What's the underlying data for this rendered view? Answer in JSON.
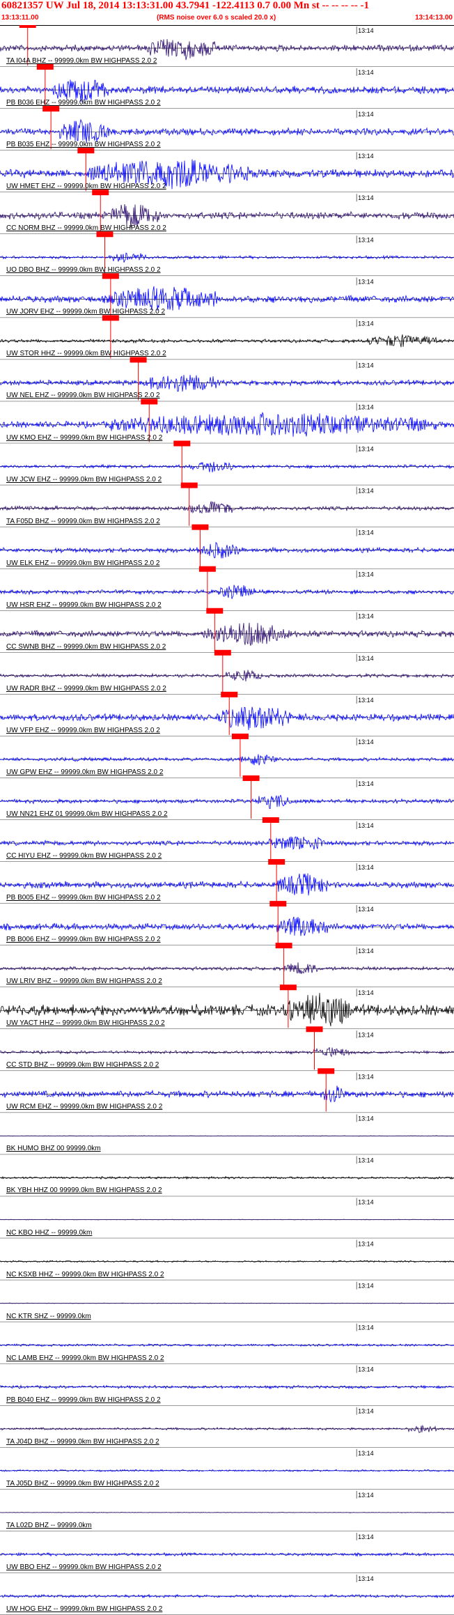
{
  "header": {
    "title": "60821357 UW Jul 18, 2014 13:13:31.00   43.7941 -122.4113  0.7 0.00 Mn st -- -- -- -- -1",
    "start_time": "13:13:11.00",
    "note": "(RMS noise over 6.0 s scaled 20.0 x)",
    "end_time": "13:14:13.00"
  },
  "colors": {
    "title": "#ff0000",
    "pick": "#ff0000",
    "trace_blue": "#0000ff",
    "trace_dark": "#2a0a6e",
    "trace_black": "#000000",
    "axis": "#000000"
  },
  "chart_data": {
    "type": "line",
    "title": "60821357 UW Jul 18, 2014 13:13:31.00   43.7941 -122.4113  0.7 0.00 Mn st -- -- -- -- -1",
    "x_axis": {
      "start": "13:13:11.00",
      "end": "13:14:13.00",
      "tick_label": "13:14",
      "tick_time_s": 49
    },
    "traces": [
      {
        "label": "TA I04A BHZ -- 99999.0km BW  HIGHPASS  2.0  2",
        "pick_s": 3.8,
        "color": "dark",
        "amp": 0.55,
        "burst": [
          20,
          30
        ]
      },
      {
        "label": "PB B036 EHZ -- 99999.0km BW  HIGHPASS  2.0  2",
        "pick_s": 6.2,
        "color": "blue",
        "amp": 0.6,
        "burst": [
          7,
          15
        ]
      },
      {
        "label": "PB B035 EHZ -- 99999.0km BW  HIGHPASS  2.0  2",
        "pick_s": 7.0,
        "color": "blue",
        "amp": 0.6,
        "burst": [
          8,
          15
        ]
      },
      {
        "label": "UW HMET EHZ -- 99999.0km BW  HIGHPASS  2.0  2",
        "pick_s": 11.8,
        "color": "blue",
        "amp": 0.7,
        "burst": [
          12,
          35
        ]
      },
      {
        "label": "CC NORM BHZ -- 99999.0km BW  HIGHPASS  2.0  2",
        "pick_s": 13.8,
        "color": "dark",
        "amp": 0.6,
        "burst": [
          15,
          22
        ]
      },
      {
        "label": "UO DBO BHZ -- 99999.0km BW  HIGHPASS  2.0  2",
        "pick_s": 14.4,
        "color": "blue",
        "amp": 0.25,
        "burst": [
          15,
          20
        ]
      },
      {
        "label": "UW JORV EHZ -- 99999.0km BW  HIGHPASS  2.0  2",
        "pick_s": 15.2,
        "color": "blue",
        "amp": 0.6,
        "burst": [
          15,
          30
        ]
      },
      {
        "label": "UW STOR HHZ -- 99999.0km BW  HIGHPASS  2.0  2",
        "pick_s": 15.2,
        "color": "black",
        "amp": 0.3,
        "burst": [
          50,
          60
        ]
      },
      {
        "label": "UW NEL EHZ -- 99999.0km BW  HIGHPASS  2.0  2",
        "pick_s": 19.0,
        "color": "blue",
        "amp": 0.45,
        "burst": [
          20,
          30
        ]
      },
      {
        "label": "UW KMO EHZ -- 99999.0km BW  HIGHPASS  2.0  2",
        "pick_s": 20.5,
        "color": "blue",
        "amp": 0.55,
        "burst": [
          15,
          60
        ]
      },
      {
        "label": "UW JCW EHZ -- 99999.0km BW  HIGHPASS  2.0  2",
        "pick_s": 25.0,
        "color": "blue",
        "amp": 0.3,
        "burst": [
          26,
          32
        ]
      },
      {
        "label": "TA F05D BHZ -- 99999.0km BW  HIGHPASS  2.0  2",
        "pick_s": 26.0,
        "color": "dark",
        "amp": 0.35,
        "burst": [
          26,
          32
        ]
      },
      {
        "label": "UW ELK EHZ -- 99999.0km BW  HIGHPASS  2.0  2",
        "pick_s": 27.5,
        "color": "blue",
        "amp": 0.4,
        "burst": [
          27,
          33
        ]
      },
      {
        "label": "UW HSR EHZ -- 99999.0km BW  HIGHPASS  2.0  2",
        "pick_s": 28.5,
        "color": "blue",
        "amp": 0.35,
        "burst": [
          30,
          35
        ]
      },
      {
        "label": "CC SWNB BHZ -- 99999.0km BW  HIGHPASS  2.0  2",
        "pick_s": 29.5,
        "color": "dark",
        "amp": 0.55,
        "burst": [
          28,
          40
        ]
      },
      {
        "label": "UW RADR BHZ -- 99999.0km BW  HIGHPASS  2.0  2",
        "pick_s": 30.6,
        "color": "dark",
        "amp": 0.3,
        "burst": [
          31,
          36
        ]
      },
      {
        "label": "UW VFP EHZ -- 99999.0km BW  HIGHPASS  2.0  2",
        "pick_s": 31.5,
        "color": "blue",
        "amp": 0.6,
        "burst": [
          30,
          40
        ]
      },
      {
        "label": "UW GPW EHZ -- 99999.0km BW  HIGHPASS  2.0  2",
        "pick_s": 33.0,
        "color": "blue",
        "amp": 0.3,
        "burst": [
          33,
          38
        ]
      },
      {
        "label": "UW NN21 EHZ 01 99999.0km BW  HIGHPASS  2.0  2",
        "pick_s": 34.5,
        "color": "blue",
        "amp": 0.35,
        "burst": [
          35,
          40
        ]
      },
      {
        "label": "CC HIYU EHZ -- 99999.0km BW  HIGHPASS  2.0  2",
        "pick_s": 37.2,
        "color": "blue",
        "amp": 0.4,
        "burst": [
          37,
          45
        ]
      },
      {
        "label": "PB B005 EHZ -- 99999.0km BW  HIGHPASS  2.0  2",
        "pick_s": 38.0,
        "color": "blue",
        "amp": 0.55,
        "burst": [
          38,
          45
        ]
      },
      {
        "label": "PB B006 EHZ -- 99999.0km BW  HIGHPASS  2.0  2",
        "pick_s": 38.2,
        "color": "blue",
        "amp": 0.55,
        "burst": [
          38,
          45
        ]
      },
      {
        "label": "UW LRIV BHZ -- 99999.0km BW  HIGHPASS  2.0  2",
        "pick_s": 39.0,
        "color": "dark",
        "amp": 0.3,
        "burst": [
          39,
          44
        ]
      },
      {
        "label": "UW YACT HHZ -- 99999.0km BW  HIGHPASS  2.0  2",
        "pick_s": 39.6,
        "color": "black",
        "amp": 0.95,
        "burst": [
          39.5,
          48
        ]
      },
      {
        "label": "CC STD BHZ -- 99999.0km BW  HIGHPASS  2.0  2",
        "pick_s": 43.2,
        "color": "dark",
        "amp": 0.25,
        "burst": [
          43,
          48
        ]
      },
      {
        "label": "UW RCM EHZ -- 99999.0km BW  HIGHPASS  2.0  2",
        "pick_s": 44.8,
        "color": "blue",
        "amp": 0.55,
        "burst": [
          44.5,
          47
        ]
      },
      {
        "label": "BK HUMO BHZ 00 99999.0km",
        "pick_s": null,
        "color": "dark",
        "amp": 0.05,
        "burst": null
      },
      {
        "label": "BK YBH HHZ 00 99999.0km BW  HIGHPASS  2.0  2",
        "pick_s": null,
        "color": "black",
        "amp": 0.2,
        "burst": null
      },
      {
        "label": "NC KBO HHZ -- 99999.0km",
        "pick_s": null,
        "color": "dark",
        "amp": 0.05,
        "burst": null
      },
      {
        "label": "NC KSXB HHZ -- 99999.0km BW  HIGHPASS  2.0  2",
        "pick_s": null,
        "color": "black",
        "amp": 0.15,
        "burst": null
      },
      {
        "label": "NC KTR SHZ -- 99999.0km",
        "pick_s": null,
        "color": "dark",
        "amp": 0.05,
        "burst": null
      },
      {
        "label": "NC LAMB EHZ -- 99999.0km BW  HIGHPASS  2.0  2",
        "pick_s": null,
        "color": "blue",
        "amp": 0.2,
        "burst": null
      },
      {
        "label": "PB B040 EHZ -- 99999.0km BW  HIGHPASS  2.0  2",
        "pick_s": null,
        "color": "blue",
        "amp": 0.25,
        "burst": null
      },
      {
        "label": "TA J04D BHZ -- 99999.0km BW  HIGHPASS  2.0  2",
        "pick_s": null,
        "color": "dark",
        "amp": 0.2,
        "burst": [
          56,
          60
        ]
      },
      {
        "label": "TA J05D BHZ -- 99999.0km BW  HIGHPASS  2.0  2",
        "pick_s": null,
        "color": "blue",
        "amp": 0.15,
        "burst": null
      },
      {
        "label": "TA L02D BHZ -- 99999.0km",
        "pick_s": null,
        "color": "dark",
        "amp": 0.05,
        "burst": null
      },
      {
        "label": "UW BBO EHZ -- 99999.0km BW  HIGHPASS  2.0  2",
        "pick_s": null,
        "color": "blue",
        "amp": 0.25,
        "burst": null
      },
      {
        "label": "UW HOG EHZ -- 99999.0km BW  HIGHPASS  2.0  2",
        "pick_s": null,
        "color": "blue",
        "amp": 0.25,
        "burst": null
      }
    ]
  }
}
